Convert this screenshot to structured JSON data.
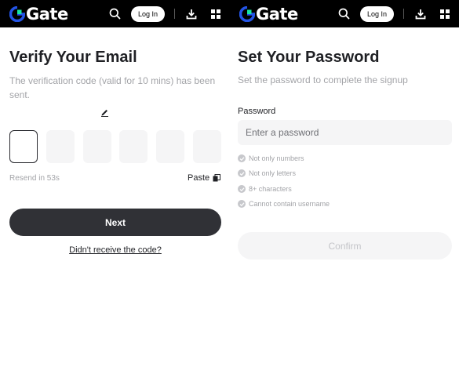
{
  "brand": {
    "name": "Gate"
  },
  "topbar": {
    "login_label": "Log In"
  },
  "verify": {
    "title": "Verify Your Email",
    "subtitle": "The verification code (valid for 10 mins) has been sent.",
    "code_boxes": [
      "",
      "",
      "",
      "",
      "",
      ""
    ],
    "resend_text": "Resend in 53s",
    "paste_label": "Paste",
    "next_label": "Next",
    "no_code_link": "Didn't receive the code?"
  },
  "password": {
    "title": "Set Your Password",
    "subtitle": "Set the password to complete the signup",
    "field_label": "Password",
    "placeholder": "Enter a password",
    "rules": [
      "Not only numbers",
      "Not only letters",
      "8+ characters",
      "Cannot contain username"
    ],
    "confirm_label": "Confirm"
  },
  "colors": {
    "topbar": "#000000",
    "brand_blue": "#2354e6",
    "brand_green": "#17e6a1",
    "primary_button": "#303136",
    "disabled_button": "#f5f5f6"
  }
}
